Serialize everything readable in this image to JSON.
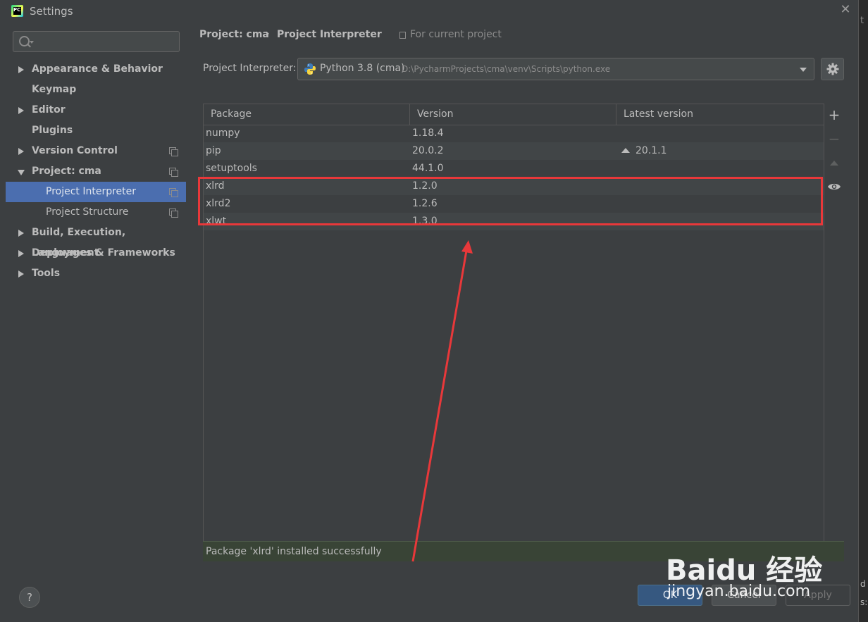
{
  "window": {
    "title": "Settings",
    "app_icon": "pycharm-icon"
  },
  "search": {
    "placeholder": "",
    "value": ""
  },
  "sidebar": {
    "items": [
      {
        "label": "Appearance & Behavior",
        "expander": "collapsed"
      },
      {
        "label": "Keymap"
      },
      {
        "label": "Editor",
        "expander": "collapsed"
      },
      {
        "label": "Plugins"
      },
      {
        "label": "Version Control",
        "expander": "collapsed"
      },
      {
        "label": "Project: cma",
        "expander": "expanded"
      },
      {
        "label": "Project Interpreter",
        "selected": true
      },
      {
        "label": "Project Structure"
      },
      {
        "label": "Build, Execution, Deployment",
        "expander": "collapsed"
      },
      {
        "label": "Languages & Frameworks",
        "expander": "collapsed"
      },
      {
        "label": "Tools",
        "expander": "collapsed"
      }
    ]
  },
  "breadcrumb": {
    "project": "Project: cma",
    "separator": "›",
    "page": "Project Interpreter",
    "scope": "For current project"
  },
  "interpreter": {
    "label": "Project Interpreter:",
    "name": "Python 3.8 (cma)",
    "path": "D:\\PycharmProjects\\cma\\venv\\Scripts\\python.exe"
  },
  "table": {
    "headers": [
      "Package",
      "Version",
      "Latest version"
    ],
    "rows": [
      {
        "package": "numpy",
        "version": "1.18.4",
        "latest": ""
      },
      {
        "package": "pip",
        "version": "20.0.2",
        "latest": "20.1.1",
        "upgrade": true
      },
      {
        "package": "setuptools",
        "version": "44.1.0",
        "latest": ""
      },
      {
        "package": "xlrd",
        "version": "1.2.0",
        "latest": ""
      },
      {
        "package": "xlrd2",
        "version": "1.2.6",
        "latest": ""
      },
      {
        "package": "xlwt",
        "version": "1.3.0",
        "latest": ""
      }
    ]
  },
  "tools": {
    "add": "+",
    "remove": "−"
  },
  "status": {
    "message": "Package 'xlrd' installed successfully"
  },
  "buttons": {
    "help": "?",
    "ok": "OK",
    "cancel": "Cancel",
    "apply": "Apply"
  },
  "watermark": {
    "logo": "Baidu 经验",
    "url": "jingyan.baidu.com"
  },
  "background_window": {
    "top_text": "t",
    "bottom_text_1": "d",
    "bottom_text_2": "s:"
  },
  "colors": {
    "selection": "#4b6eaf",
    "highlight_box": "#e8383a",
    "status_success_bg": "#394436",
    "ok_button": "#365880"
  }
}
